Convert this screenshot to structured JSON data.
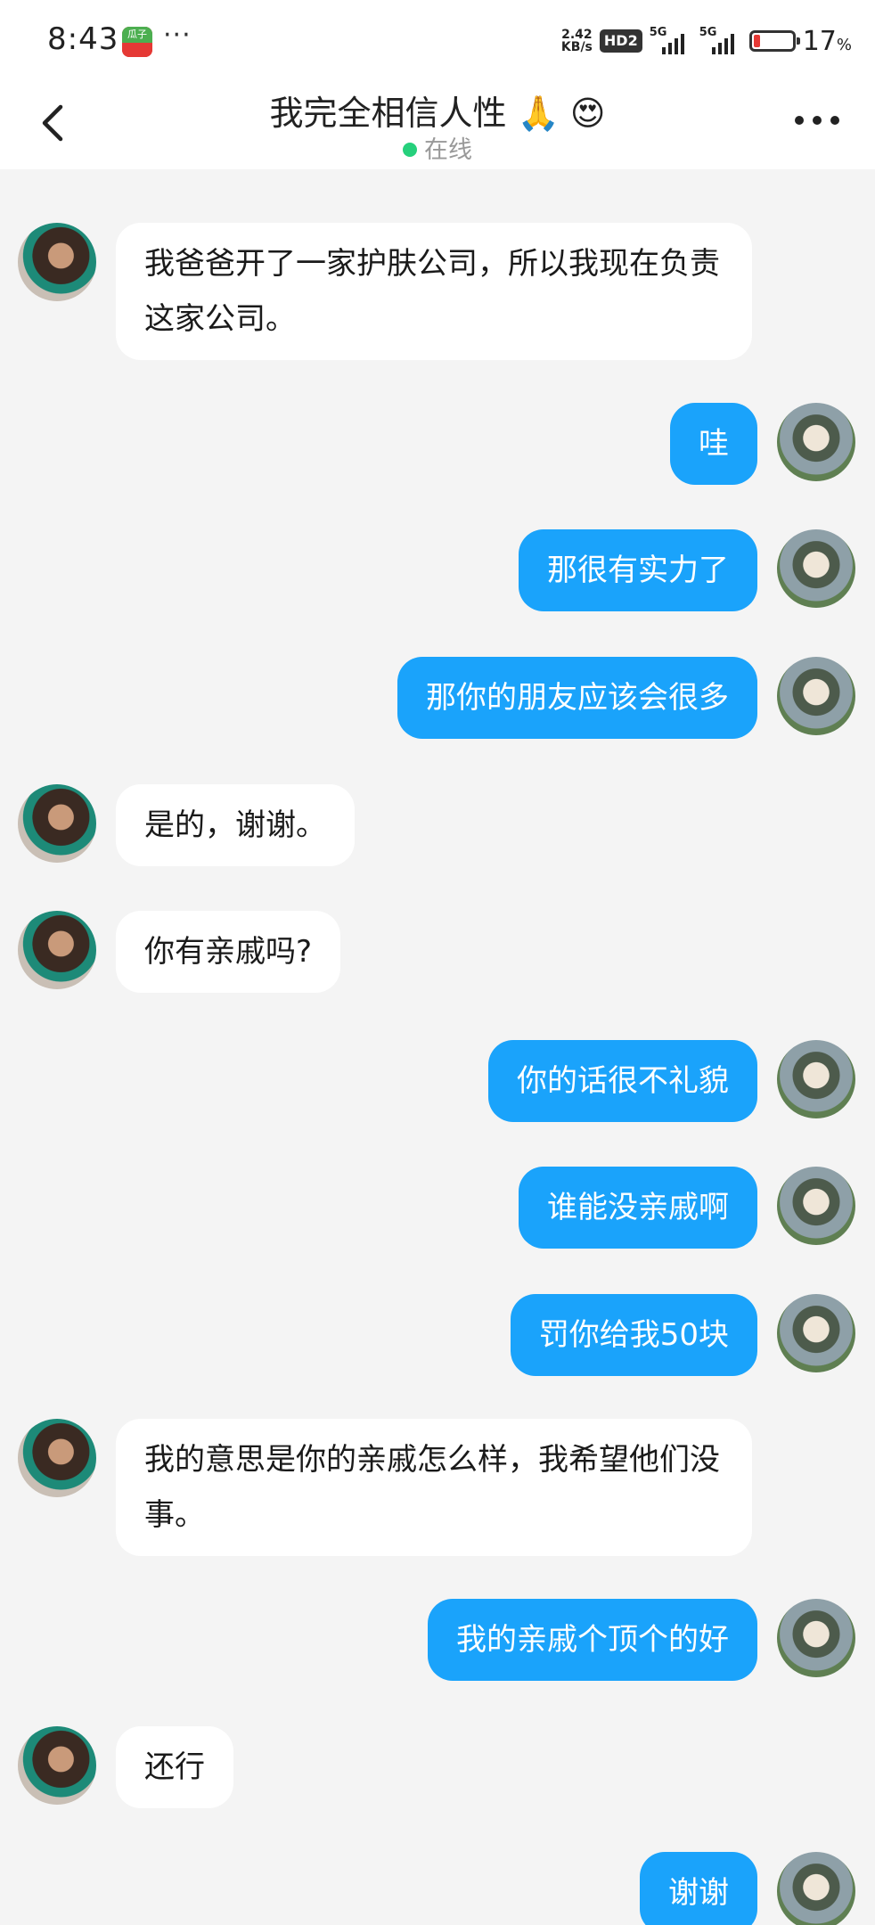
{
  "status_bar": {
    "time": "8:43",
    "notification_app_icon": "app-notification-icon",
    "more_dots": "···",
    "net_speed_value": "2.42",
    "net_speed_unit": "KB/s",
    "hd_label": "HD2",
    "signal1_label": "5G",
    "signal2_label": "5G",
    "battery_level": 0.17,
    "battery_text": "17",
    "battery_unit": "%"
  },
  "header": {
    "title": "我完全相信人性 🙏 😍",
    "online_status": "在线",
    "online_color": "#26d07c",
    "back_icon": "back-arrow-icon",
    "more_icon": "more-options-icon"
  },
  "colors": {
    "outgoing_bubble": "#1aa3fb",
    "incoming_bubble": "#ffffff",
    "background": "#f4f4f4"
  },
  "messages": [
    {
      "direction": "in",
      "text": "我爸爸开了一家护肤公司，所以我现在负责这家公司。"
    },
    {
      "direction": "out",
      "text": "哇"
    },
    {
      "direction": "out",
      "text": "那很有实力了"
    },
    {
      "direction": "out",
      "text": "那你的朋友应该会很多"
    },
    {
      "direction": "in",
      "text": "是的，谢谢。"
    },
    {
      "direction": "in",
      "text": "你有亲戚吗?"
    },
    {
      "direction": "out",
      "text": "你的话很不礼貌"
    },
    {
      "direction": "out",
      "text": "谁能没亲戚啊"
    },
    {
      "direction": "out",
      "text": "罚你给我50块"
    },
    {
      "direction": "in",
      "text": "我的意思是你的亲戚怎么样，我希望他们没事。"
    },
    {
      "direction": "out",
      "text": "我的亲戚个顶个的好"
    },
    {
      "direction": "in",
      "text": "还行"
    },
    {
      "direction": "out",
      "text": "谢谢"
    }
  ]
}
